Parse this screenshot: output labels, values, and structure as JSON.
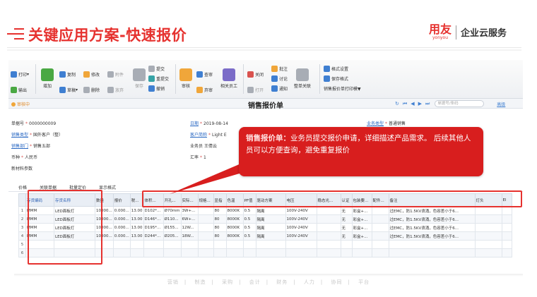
{
  "slide": {
    "title": "关键应用方案-快速报价",
    "logo_main": "用友",
    "logo_en": "yonyou",
    "logo_tagline": "企业云服务"
  },
  "toolbar": {
    "print": "打印",
    "output": "输出",
    "add": "增加",
    "copy": "复制",
    "draft": "草稿",
    "edit": "修改",
    "delete": "删除",
    "attach": "附件",
    "discard": "放弃",
    "save": "保存",
    "submit": "提交",
    "resubmit": "重提交",
    "withdraw": "撤销",
    "audit": "审核",
    "query": "查审",
    "reject": "弃审",
    "related": "相关员工",
    "close": "关闭",
    "open": "打开",
    "annotate": "批注",
    "discuss": "讨论",
    "notify": "通知",
    "whole_relate": "整单关联",
    "format_setting": "格式设置",
    "save_format": "保存格式",
    "print_template": "销售报价单打印模▼"
  },
  "formbar": {
    "status": "审核中",
    "title": "销售报价单",
    "search_placeholder": "单据号/条码",
    "advanced": "高级",
    "nav_arrows": [
      "↻",
      "⏮",
      "◀",
      "▶",
      "⏭"
    ]
  },
  "header_fields": {
    "doc_no_label": "单据号",
    "doc_no": "0000000009",
    "sales_type_label": "销售类型",
    "sales_type": "国外客户（整）",
    "sales_dept_label": "销售部门",
    "sales_dept": "销售五部",
    "currency_label": "币种",
    "currency": "人民币",
    "new_material_label": "新材料参数",
    "date_label": "日期",
    "date": "2019-08-14",
    "customer_label": "客户简称",
    "customer": "Light E",
    "salesman_label": "业务员",
    "salesman": "王倩云",
    "rate_label": "汇率",
    "rate": "1",
    "biz_type_label": "业务类型",
    "biz_type": "普通销售"
  },
  "tabs": [
    "价格",
    "关联单据",
    "批量定价",
    "显示格式"
  ],
  "grid": {
    "columns": [
      "",
      "存货编码",
      "存货名称",
      "数量",
      "报价",
      "税...",
      "体积...",
      "开孔...",
      "实际...",
      "规格...",
      "显指",
      "色温",
      "PF值",
      "驱动方案",
      "电压",
      "稳态光...",
      "认证",
      "包装要...",
      "配件...",
      "备注",
      "灯头",
      "El"
    ],
    "rows": [
      [
        "1",
        "MMM",
        "LED面板灯",
        "10000...",
        "0.000...",
        "13.00",
        "D102*...",
        "Ø70mm",
        "3W+...",
        "",
        "80",
        "8000K",
        "0.5",
        "隔离",
        "100V-240V",
        "",
        "无",
        "彩盒+...",
        "",
        "过EMC，防1.5KV浪涌，色容差小于6...",
        "",
        ""
      ],
      [
        "2",
        "MMM",
        "LED面板灯",
        "10000...",
        "0.000...",
        "13.00",
        "D146*...",
        "Ø110...",
        "6W+...",
        "",
        "80",
        "8000K",
        "0.5",
        "隔离",
        "100V-240V",
        "",
        "无",
        "彩盒+...",
        "",
        "过EMC，防1.5KV浪涌，色容差小于6...",
        "",
        ""
      ],
      [
        "3",
        "MMM",
        "LED面板灯",
        "10000...",
        "0.000...",
        "13.00",
        "D195*...",
        "Ø155...",
        "12W...",
        "",
        "80",
        "8000K",
        "0.5",
        "隔离",
        "100V-240V",
        "",
        "无",
        "彩盒+...",
        "",
        "过EMC，防1.5KV浪涌，色容差小于6...",
        "",
        ""
      ],
      [
        "4",
        "MMM",
        "LED面板灯",
        "10000...",
        "0.000...",
        "13.00",
        "D244*...",
        "Ø205...",
        "18W...",
        "",
        "80",
        "8000K",
        "0.5",
        "隔离",
        "100V-240V",
        "",
        "无",
        "彩盒+...",
        "",
        "过EMC，防1.5KV浪涌，色容差小于6...",
        "",
        ""
      ],
      [
        "5",
        "",
        "",
        "",
        "",
        "",
        "",
        "",
        "",
        "",
        "",
        "",
        "",
        "",
        "",
        "",
        "",
        "",
        "",
        "",
        "",
        ""
      ],
      [
        "6",
        "",
        "",
        "",
        "",
        "",
        "",
        "",
        "",
        "",
        "",
        "",
        "",
        "",
        "",
        "",
        "",
        "",
        "",
        "",
        "",
        ""
      ]
    ]
  },
  "callout": {
    "heading": "销售报价单：",
    "text": "业务员提交报价申请，详细描述产品需求。 后续其他人员可以方便查询，避免重复报价"
  },
  "footer": [
    "营销",
    "制造",
    "采购",
    "会计",
    "财务",
    "人力",
    "协同",
    "平台"
  ],
  "colors": {
    "accent": "#e6322f",
    "callout_bg": "#d81e1e",
    "link": "#2c6ac4"
  }
}
